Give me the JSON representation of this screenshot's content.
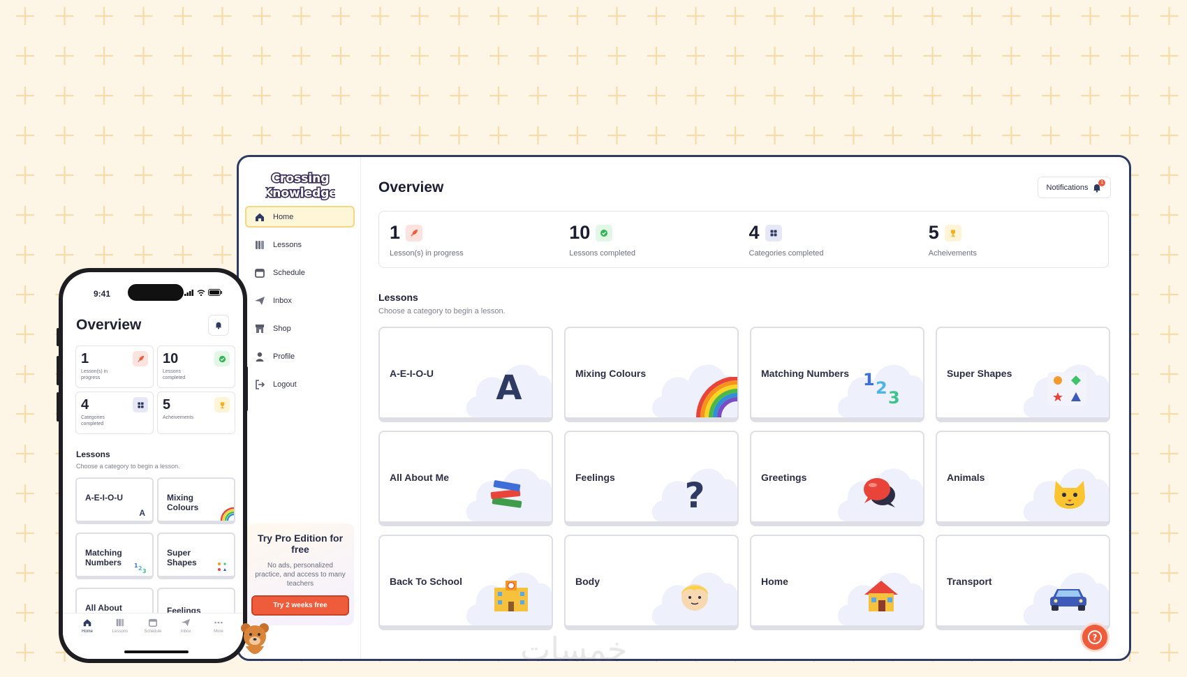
{
  "colors": {
    "background": "#fdf5e6",
    "pattern": "#f6deb0",
    "accent": "#ef5c3b",
    "active_nav_bg": "#fff6d8",
    "navy": "#2f3a63"
  },
  "brand": {
    "line1": "Crossing",
    "line2": "Knowledge"
  },
  "sidebar": {
    "items": [
      {
        "label": "Home",
        "icon": "home-icon",
        "active": true
      },
      {
        "label": "Lessons",
        "icon": "book-icon",
        "active": false
      },
      {
        "label": "Schedule",
        "icon": "calendar-icon",
        "active": false
      },
      {
        "label": "Inbox",
        "icon": "paper-plane-icon",
        "active": false
      },
      {
        "label": "Shop",
        "icon": "store-icon",
        "active": false
      },
      {
        "label": "Profile",
        "icon": "user-icon",
        "active": false
      },
      {
        "label": "Logout",
        "icon": "logout-icon",
        "active": false
      }
    ],
    "pro": {
      "title": "Try Pro Edition for free",
      "description": "No ads, personalized practice, and access to many teachers",
      "button": "Try 2 weeks free"
    }
  },
  "main": {
    "title": "Overview",
    "notifications": {
      "label": "Notifications",
      "count": "1"
    },
    "stats": [
      {
        "value": "1",
        "label": "Lesson(s) in progress",
        "icon": "rocket-icon",
        "color": "#fde3e0"
      },
      {
        "value": "10",
        "label": "Lessons completed",
        "icon": "check-circle-icon",
        "color": "#e3f7e6"
      },
      {
        "value": "4",
        "label": "Categories completed",
        "icon": "grid-icon",
        "color": "#e6e8f7"
      },
      {
        "value": "5",
        "label": "Acheivements",
        "icon": "trophy-icon",
        "color": "#fff5d6"
      }
    ],
    "lessons_title": "Lessons",
    "lessons_subtitle": "Choose a category to begin a lesson.",
    "categories": [
      {
        "label": "A-E-I-O-U",
        "icon": "letter-a-icon"
      },
      {
        "label": "Mixing Colours",
        "icon": "rainbow-icon"
      },
      {
        "label": "Matching Numbers",
        "icon": "numbers-icon"
      },
      {
        "label": "Super Shapes",
        "icon": "shapes-icon"
      },
      {
        "label": "All About Me",
        "icon": "books-icon"
      },
      {
        "label": "Feelings",
        "icon": "question-mark-icon"
      },
      {
        "label": "Greetings",
        "icon": "speech-bubbles-icon"
      },
      {
        "label": "Animals",
        "icon": "cat-icon"
      },
      {
        "label": "Back To School",
        "icon": "school-icon"
      },
      {
        "label": "Body",
        "icon": "child-face-icon"
      },
      {
        "label": "Home",
        "icon": "house-icon"
      },
      {
        "label": "Transport",
        "icon": "car-icon"
      }
    ]
  },
  "phone": {
    "time": "9:41",
    "title": "Overview",
    "stats": [
      {
        "value": "1",
        "label": "Lesson(s) in progress"
      },
      {
        "value": "10",
        "label": "Lessons completed"
      },
      {
        "value": "4",
        "label": "Categories completed"
      },
      {
        "value": "5",
        "label": "Acheivements"
      }
    ],
    "lessons_title": "Lessons",
    "lessons_subtitle": "Choose a category to begin a lesson.",
    "categories": [
      "A-E-I-O-U",
      "Mixing Colours",
      "Matching Numbers",
      "Super Shapes",
      "All About",
      "Feelings"
    ],
    "tabs": [
      "Home",
      "Lessons",
      "Schedule",
      "Inbox",
      "More"
    ]
  },
  "watermark": "خمسات"
}
